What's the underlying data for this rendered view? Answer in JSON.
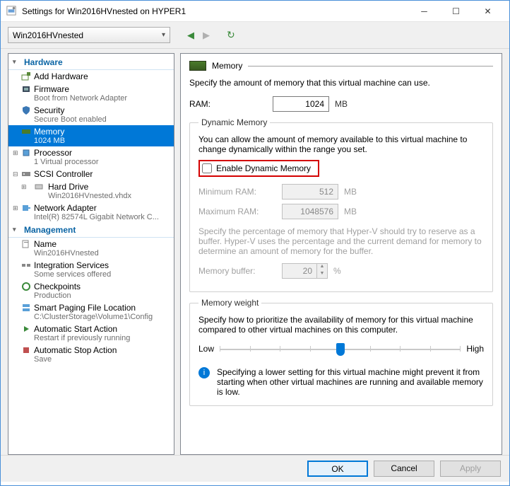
{
  "window": {
    "title": "Settings for Win2016HVnested on HYPER1",
    "vm_selected": "Win2016HVnested"
  },
  "tree": {
    "hardware_label": "Hardware",
    "management_label": "Management",
    "items": {
      "add_hw": "Add Hardware",
      "firmware": "Firmware",
      "firmware_sub": "Boot from Network Adapter",
      "security": "Security",
      "security_sub": "Secure Boot enabled",
      "memory": "Memory",
      "memory_sub": "1024 MB",
      "processor": "Processor",
      "processor_sub": "1 Virtual processor",
      "scsi": "SCSI Controller",
      "hdd": "Hard Drive",
      "hdd_sub": "Win2016HVnested.vhdx",
      "net": "Network Adapter",
      "net_sub": "Intel(R) 82574L Gigabit Network C...",
      "name": "Name",
      "name_sub": "Win2016HVnested",
      "integ": "Integration Services",
      "integ_sub": "Some services offered",
      "chk": "Checkpoints",
      "chk_sub": "Production",
      "paging": "Smart Paging File Location",
      "paging_sub": "C:\\ClusterStorage\\Volume1\\Config",
      "astart": "Automatic Start Action",
      "astart_sub": "Restart if previously running",
      "astop": "Automatic Stop Action",
      "astop_sub": "Save"
    }
  },
  "content": {
    "header": "Memory",
    "intro": "Specify the amount of memory that this virtual machine can use.",
    "ram_label": "RAM:",
    "ram_value": "1024",
    "mb": "MB",
    "dyn": {
      "legend": "Dynamic Memory",
      "desc": "You can allow the amount of memory available to this virtual machine to change dynamically within the range you set.",
      "enable_label": "Enable Dynamic Memory",
      "min_label": "Minimum RAM:",
      "min_value": "512",
      "max_label": "Maximum RAM:",
      "max_value": "1048576",
      "buffer_desc": "Specify the percentage of memory that Hyper-V should try to reserve as a buffer. Hyper-V uses the percentage and the current demand for memory to determine an amount of memory for the buffer.",
      "buffer_label": "Memory buffer:",
      "buffer_value": "20",
      "percent": "%"
    },
    "weight": {
      "legend": "Memory weight",
      "desc": "Specify how to prioritize the availability of memory for this virtual machine compared to other virtual machines on this computer.",
      "low": "Low",
      "high": "High",
      "info": "Specifying a lower setting for this virtual machine might prevent it from starting when other virtual machines are running and available memory is low."
    }
  },
  "footer": {
    "ok": "OK",
    "cancel": "Cancel",
    "apply": "Apply"
  }
}
